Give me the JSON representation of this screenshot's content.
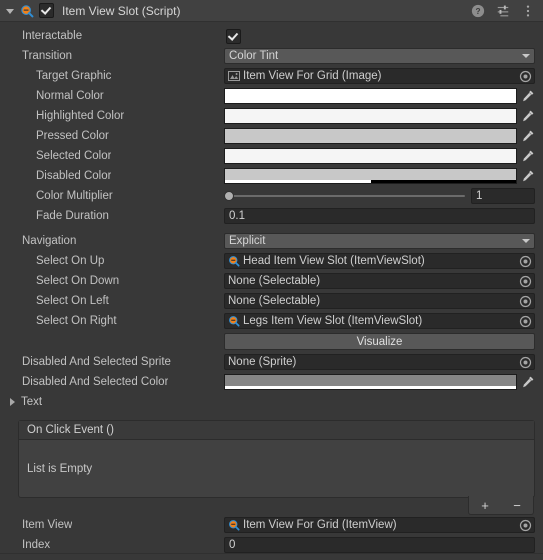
{
  "header": {
    "title": "Item View Slot (Script)",
    "enabled_checkbox": true,
    "foldout_open": true,
    "script_icon": "script-icon",
    "help_icon": "help-icon",
    "preset_icon": "preset-icon",
    "menu_icon": "kebab-menu-icon"
  },
  "colors": {
    "panel_bg": "#383838",
    "header_bg": "#414141",
    "field_bg": "#2a2a2a",
    "dropdown_bg": "#585858",
    "label": "#c2c2c2"
  },
  "properties": {
    "interactable": {
      "label": "Interactable",
      "value": true
    },
    "transition": {
      "label": "Transition",
      "value": "Color Tint"
    },
    "target_graphic": {
      "label": "Target Graphic",
      "value": "Item View For Grid (Image)",
      "icon": "image-component-icon"
    },
    "normal_color": {
      "label": "Normal Color",
      "swatch": "#FFFFFF",
      "alpha": 100
    },
    "highlighted_color": {
      "label": "Highlighted Color",
      "swatch": "#F5F5F5",
      "alpha": 100
    },
    "pressed_color": {
      "label": "Pressed Color",
      "swatch": "#C8C8C8",
      "alpha": 100
    },
    "selected_color": {
      "label": "Selected Color",
      "swatch": "#F5F5F5",
      "alpha": 100
    },
    "disabled_color": {
      "label": "Disabled Color",
      "swatch": "#C8C8C8",
      "alpha": 50
    },
    "color_multiplier": {
      "label": "Color Multiplier",
      "value": "1",
      "slider_pct": 0
    },
    "fade_duration": {
      "label": "Fade Duration",
      "value": "0.1"
    },
    "navigation": {
      "label": "Navigation",
      "value": "Explicit"
    },
    "select_on_up": {
      "label": "Select On Up",
      "value": "Head Item View Slot (ItemViewSlot)",
      "icon": "script-icon"
    },
    "select_on_down": {
      "label": "Select On Down",
      "value": "None (Selectable)",
      "icon": "none"
    },
    "select_on_left": {
      "label": "Select On Left",
      "value": "None (Selectable)",
      "icon": "none"
    },
    "select_on_right": {
      "label": "Select On Right",
      "value": "Legs Item View Slot (ItemViewSlot)",
      "icon": "script-icon"
    },
    "visualize": {
      "label": "Visualize"
    },
    "disabled_and_selected_sprite": {
      "label": "Disabled And Selected Sprite",
      "value": "None (Sprite)",
      "icon": "none"
    },
    "disabled_and_selected_color": {
      "label": "Disabled And Selected Color",
      "swatch": "#858585",
      "alpha": 100
    },
    "text_foldout": {
      "label": "Text"
    },
    "item_view": {
      "label": "Item View",
      "value": "Item View For Grid (ItemView)",
      "icon": "script-icon"
    },
    "index": {
      "label": "Index",
      "value": "0"
    }
  },
  "on_click_event": {
    "title": "On Click Event ()",
    "empty_text": "List is Empty",
    "add_label": "+",
    "remove_label": "−"
  }
}
